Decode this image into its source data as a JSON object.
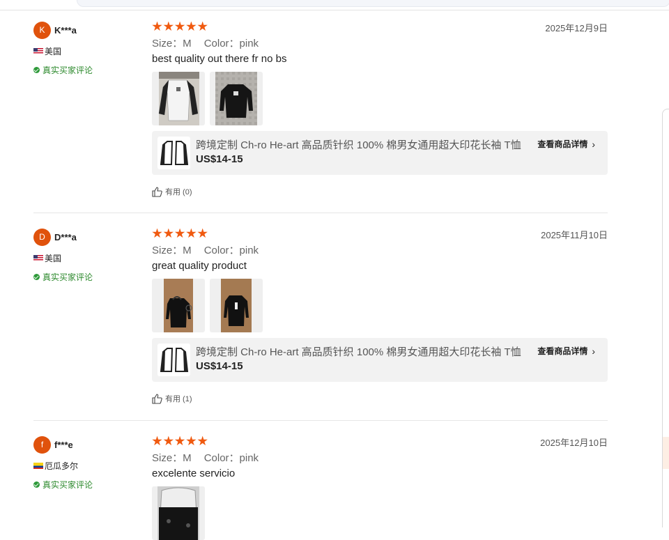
{
  "reviews": [
    {
      "avatar_letter": "K",
      "username": "K***a",
      "country": "美国",
      "flag": "us",
      "verified_label": "真实买家评论",
      "rating": 5,
      "date": "2025年12月9日",
      "size_label": "Size：M",
      "color_label": "Color：pink",
      "text": "best quality out there fr no bs",
      "product_title": "跨境定制 Ch-ro He-art 高品质针织 100% 棉男女通用超大印花长袖 T恤",
      "product_price": "US$14-15",
      "product_link": "查看商品详情",
      "helpful": "有用 (0)"
    },
    {
      "avatar_letter": "D",
      "username": "D***a",
      "country": "美国",
      "flag": "us",
      "verified_label": "真实买家评论",
      "rating": 5,
      "date": "2025年11月10日",
      "size_label": "Size：M",
      "color_label": "Color：pink",
      "text": "great quality product",
      "product_title": "跨境定制 Ch-ro He-art 高品质针织 100% 棉男女通用超大印花长袖 T恤",
      "product_price": "US$14-15",
      "product_link": "查看商品详情",
      "helpful": "有用 (1)"
    },
    {
      "avatar_letter": "f",
      "username": "f***e",
      "country": "厄瓜多尔",
      "flag": "ec",
      "verified_label": "真实买家评论",
      "rating": 5,
      "date": "2025年12月10日",
      "size_label": "Size：M",
      "color_label": "Color：pink",
      "text": "excelente servicio"
    }
  ],
  "colors": {
    "star": "#f05a10",
    "avatar": "#e0520c",
    "verified": "#2e8a2e"
  }
}
